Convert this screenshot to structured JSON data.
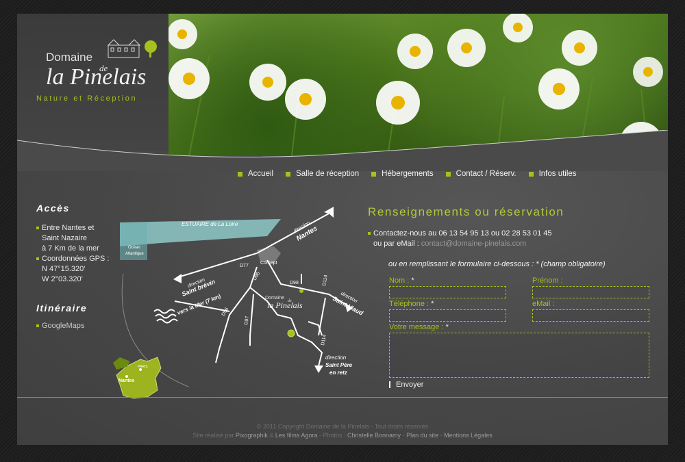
{
  "brand": {
    "logo_domaine": "Domaine",
    "logo_de": "de",
    "logo_pinelais": "la Pinelais",
    "tagline": "Nature et Réception",
    "accent": "#a7c01c"
  },
  "nav": {
    "items": [
      {
        "label": "Accueil"
      },
      {
        "label": "Salle de réception"
      },
      {
        "label": "Hébergements"
      },
      {
        "label": "Contact / Réserv."
      },
      {
        "label": "Infos utiles"
      }
    ]
  },
  "acces": {
    "title": "Accès",
    "line1": "Entre Nantes et",
    "line2": "Saint Nazaire",
    "line3": "à 7 Km de la mer",
    "line4": "Coordonnées GPS :",
    "line5": "N 47°15.320'",
    "line6": "W 2°03.320'"
  },
  "itineraire": {
    "title": "Itinéraire",
    "link": "GoogleMaps"
  },
  "map": {
    "estuaire": "ESTUAIRE de La Loire",
    "ocean1": "Océan",
    "ocean2": "Atlantique",
    "corsept": "Corsept",
    "d77": "D77",
    "d96a": "D96",
    "d96b": "D96",
    "d97": "D97",
    "d98": "D98",
    "d114a": "D114",
    "d114b": "D114",
    "dir_nantes_small": "direction",
    "dir_nantes": "Nantes",
    "dir_brevin_small": "direction",
    "dir_brevin": "Saint brévin",
    "vers_mer": "vers la Mer (7 km)",
    "dir_viaud_small": "direction",
    "dir_viaud": "Saint Viaud",
    "dir_pere_small": "direction",
    "dir_pere1": "Saint Père",
    "dir_pere2": "en retz",
    "map_logo_domaine": "Domaine",
    "map_logo_de": "de",
    "map_logo_pinelais": "la Pinelais",
    "france_paris": "PARIS",
    "france_nantes": "Nantes"
  },
  "form": {
    "title": "Renseignements ou réservation",
    "contact_phone": "Contactez-nous au 06 13 54 95 13 ou 02 28 53 01 45",
    "contact_email_prefix": "ou par eMail :",
    "contact_email": "contact@domaine-pinelais.com",
    "intro": "ou en remplissant le formulaire ci-dessous : * (champ obligatoire)",
    "nom_label": "Nom :",
    "prenom_label": "Prénom :",
    "tel_label": "Téléphone :",
    "email_label": "eMail :",
    "message_label": "Votre message :",
    "required_star": "*",
    "send_label": "Envoyer"
  },
  "footer": {
    "copyright": "© 2011 Copyright Domaine de la Pinelais - Tout droits réservés",
    "realise_par": "Site réalisé par",
    "pixographik": "Pixographik",
    "and": "&",
    "films_agora": "Les films Agora",
    "photos": "- Photos :",
    "photographer": "Christelle Bonnamy",
    "sep1": "-",
    "plan": "Plan du site",
    "sep2": "-",
    "mentions": "Mentions Légales"
  }
}
